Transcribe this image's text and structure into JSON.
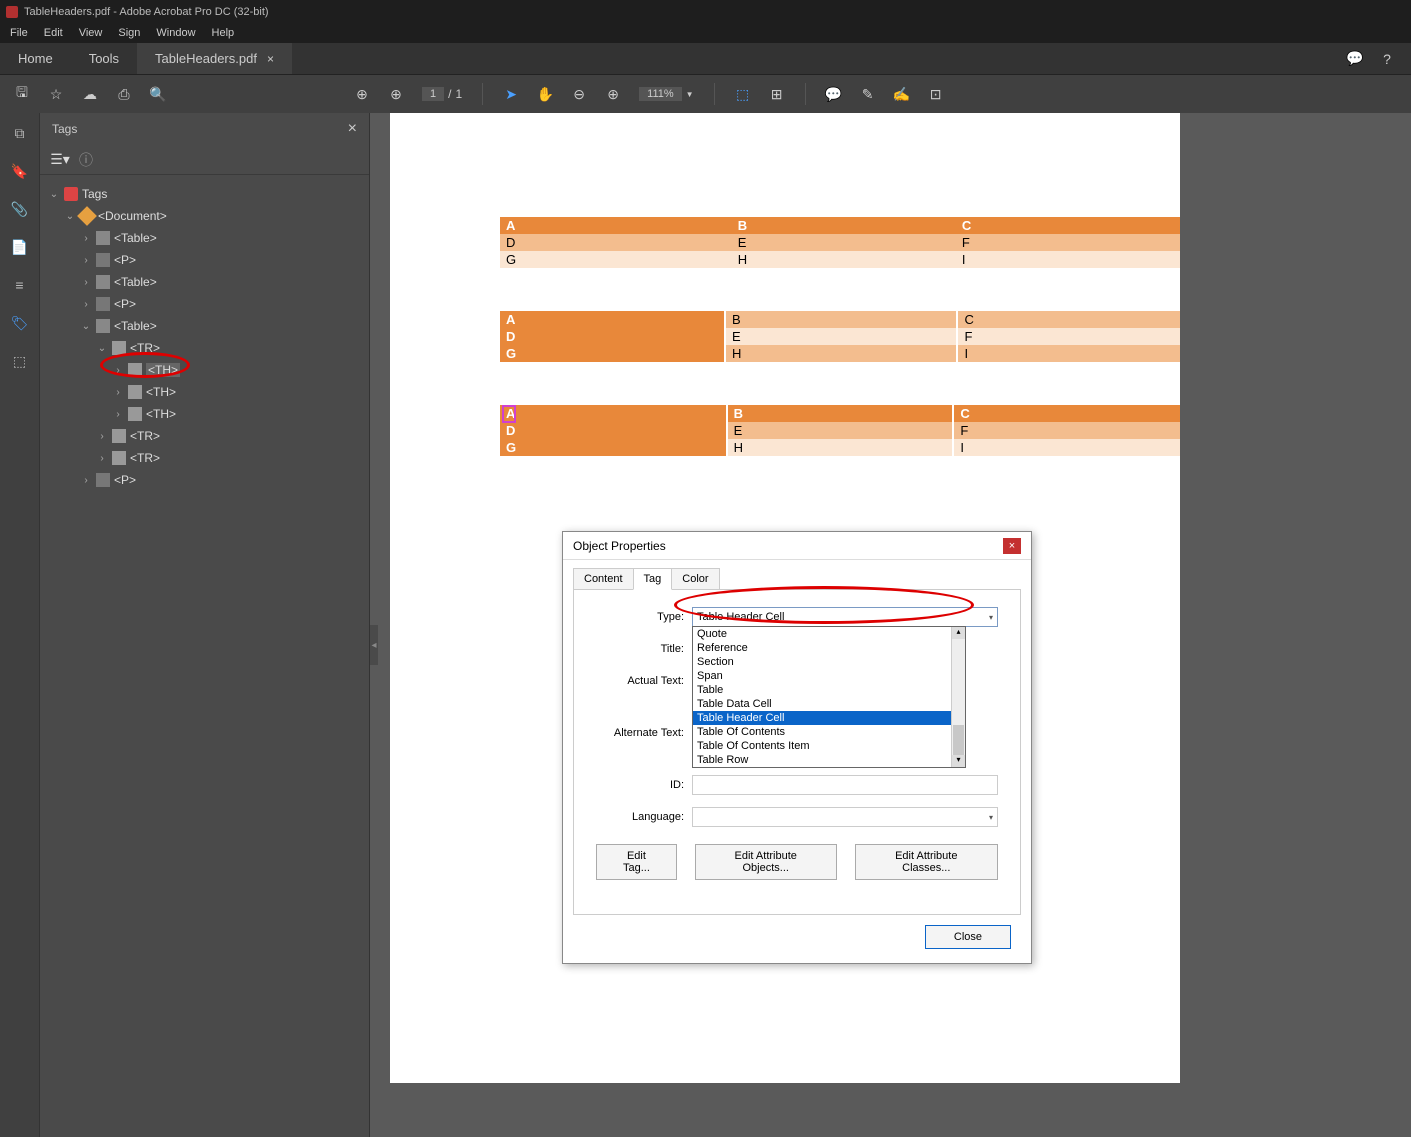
{
  "titlebar": "TableHeaders.pdf - Adobe Acrobat Pro DC (32-bit)",
  "menu": [
    "File",
    "Edit",
    "View",
    "Sign",
    "Window",
    "Help"
  ],
  "tabs": {
    "home": "Home",
    "tools": "Tools",
    "doc": "TableHeaders.pdf"
  },
  "toolbar": {
    "page_cur": "1",
    "page_sep": "/",
    "page_tot": "1",
    "zoom": "111%"
  },
  "tagspanel": {
    "title": "Tags"
  },
  "tree": {
    "root": "Tags",
    "doc": "<Document>",
    "table": "<Table>",
    "p": "<P>",
    "tr": "<TR>",
    "th": "<TH>"
  },
  "page_tables": {
    "t1": [
      [
        "A",
        "B",
        "C"
      ],
      [
        "D",
        "E",
        "F"
      ],
      [
        "G",
        "H",
        "I"
      ]
    ],
    "t2": [
      [
        "A",
        "B",
        "C"
      ],
      [
        "D",
        "E",
        "F"
      ],
      [
        "G",
        "H",
        "I"
      ]
    ],
    "t3": [
      [
        "A",
        "B",
        "C"
      ],
      [
        "D",
        "E",
        "F"
      ],
      [
        "G",
        "H",
        "I"
      ]
    ]
  },
  "dialog": {
    "title": "Object Properties",
    "tabs": [
      "Content",
      "Tag",
      "Color"
    ],
    "active_tab": "Tag",
    "labels": {
      "type": "Type:",
      "title": "Title:",
      "actual": "Actual Text:",
      "alt": "Alternate Text:",
      "id": "ID:",
      "lang": "Language:"
    },
    "type_value": "Table Header Cell",
    "dropdown": [
      "Quote",
      "Reference",
      "Section",
      "Span",
      "Table",
      "Table Data Cell",
      "Table Header Cell",
      "Table Of Contents",
      "Table Of Contents Item",
      "Table Row"
    ],
    "dropdown_selected": "Table Header Cell",
    "buttons": {
      "edit_tag": "Edit Tag...",
      "edit_attr_obj": "Edit Attribute Objects...",
      "edit_attr_cls": "Edit Attribute Classes...",
      "close": "Close"
    }
  }
}
